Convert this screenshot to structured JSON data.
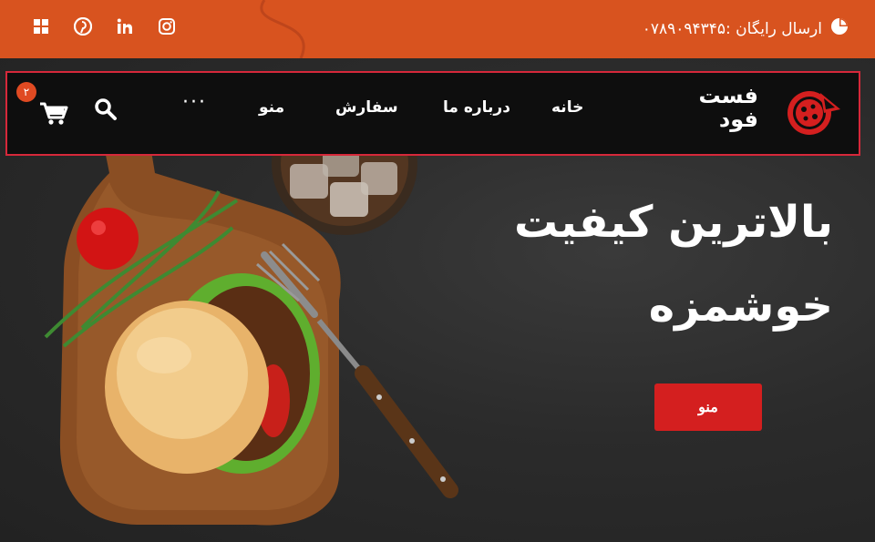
{
  "topbar": {
    "shipping_text": "ارسال رایگان :۰۷۸۹۰۹۴۳۴۵",
    "social_icons": [
      "windows-icon",
      "pinterest-icon",
      "linkedin-icon",
      "instagram-icon"
    ]
  },
  "nav": {
    "brand_line1": "فست",
    "brand_line2": "فود",
    "links": {
      "home": "خانه",
      "about": "درباره ما",
      "order": "سفارش",
      "menu": "منو"
    },
    "more": "···",
    "cart_count": "۲"
  },
  "hero": {
    "headline_line1": "بالاترین کیفیت",
    "headline_line2": "خوشمزه",
    "cta_label": "منو"
  },
  "colors": {
    "topbar": "#d8531f",
    "accent_red": "#d41f1f",
    "nav_bg": "#0e0e0e",
    "outline": "#d6283a"
  }
}
